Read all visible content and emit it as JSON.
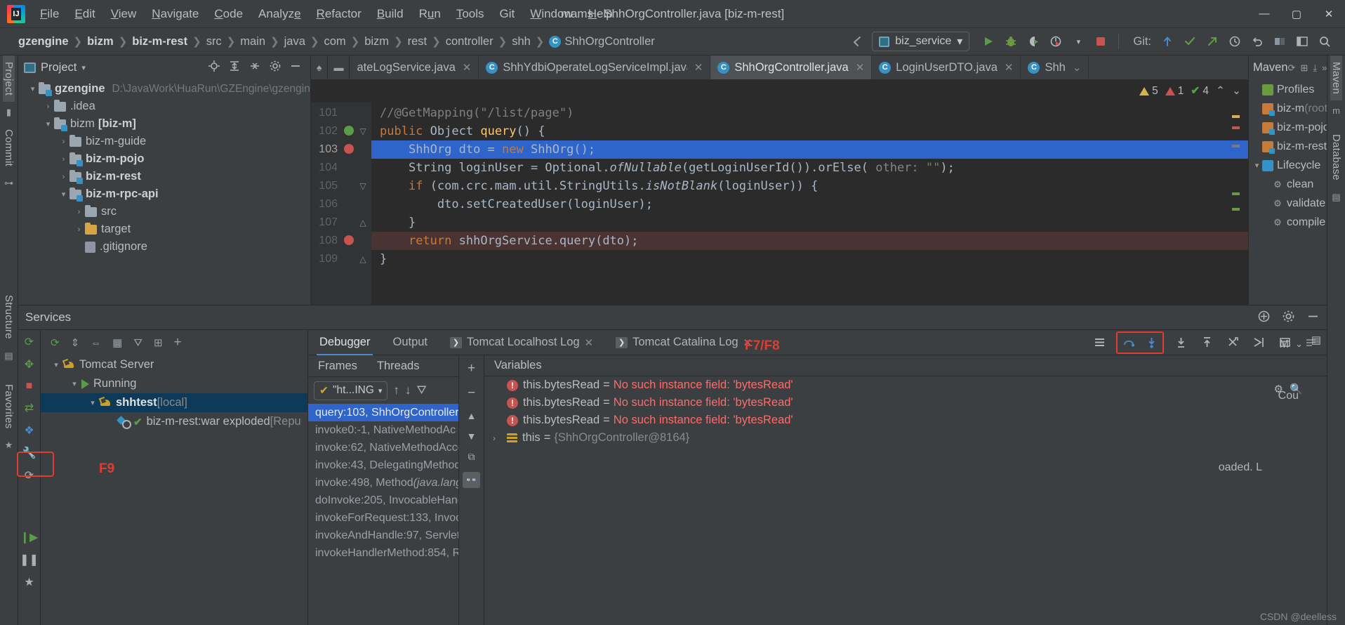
{
  "window": {
    "title": "mams - ShhOrgController.java [biz-m-rest]"
  },
  "menubar": {
    "items": [
      "File",
      "Edit",
      "View",
      "Navigate",
      "Code",
      "Analyze",
      "Refactor",
      "Build",
      "Run",
      "Tools",
      "Git",
      "Window",
      "Help"
    ]
  },
  "window_controls": {
    "minimize": "—",
    "maximize": "▢",
    "close": "✕"
  },
  "breadcrumb": {
    "items": [
      "gzengine",
      "bizm",
      "biz-m-rest",
      "src",
      "main",
      "java",
      "com",
      "bizm",
      "rest",
      "controller",
      "shh"
    ],
    "bold_count": 3,
    "class_icon": "C",
    "class_name": "ShhOrgController"
  },
  "toolbar": {
    "run_config": "biz_service",
    "run_config_icon": "tomcat-config-icon",
    "dropdown_caret": "▾",
    "run_button": "run-icon",
    "debug_button": "debug-icon",
    "run_coverage_button": "run-with-coverage-icon",
    "profiler_button": "profiler-icon",
    "stop_button": "stop-icon",
    "git_label": "Git:",
    "git_update": "update-project-icon",
    "git_commit": "commit-icon",
    "git_push": "push-icon",
    "history": "history-icon",
    "undo": "undo-icon",
    "search": "search-everywhere-icon"
  },
  "left_rail": {
    "items": [
      "Project",
      "Commit",
      "Structure",
      "Favorites"
    ]
  },
  "right_rail": {
    "items": [
      "Maven",
      "Database"
    ]
  },
  "project_panel": {
    "title": "Project",
    "caret": "▾",
    "toolbar_icons": [
      "locate-icon",
      "expand-all-icon",
      "collapse-all-icon",
      "settings-icon",
      "hide-icon"
    ],
    "tree": [
      {
        "depth": 0,
        "arrow": "▾",
        "label": "gzengine",
        "bold": true,
        "path": "D:\\JavaWork\\HuaRun\\GZEngine\\gzengine",
        "icon": "module-folder-icon"
      },
      {
        "depth": 1,
        "arrow": "›",
        "label": ".idea",
        "bold": false,
        "path": "",
        "icon": "folder-icon"
      },
      {
        "depth": 1,
        "arrow": "▾",
        "label": "bizm",
        "bold": false,
        "module": "[biz-m]",
        "path": "",
        "icon": "module-folder-icon"
      },
      {
        "depth": 2,
        "arrow": "›",
        "label": "biz-m-guide",
        "bold": false,
        "path": "",
        "icon": "folder-icon"
      },
      {
        "depth": 2,
        "arrow": "›",
        "label": "biz-m-pojo",
        "bold": true,
        "path": "",
        "icon": "module-folder-icon"
      },
      {
        "depth": 2,
        "arrow": "›",
        "label": "biz-m-rest",
        "bold": true,
        "path": "",
        "icon": "module-folder-icon"
      },
      {
        "depth": 2,
        "arrow": "▾",
        "label": "biz-m-rpc-api",
        "bold": true,
        "path": "",
        "icon": "module-folder-icon"
      },
      {
        "depth": 3,
        "arrow": "›",
        "label": "src",
        "bold": false,
        "path": "",
        "icon": "folder-icon"
      },
      {
        "depth": 3,
        "arrow": "›",
        "label": "target",
        "bold": false,
        "path": "",
        "icon": "target-folder-icon"
      },
      {
        "depth": 3,
        "arrow": "",
        "label": ".gitignore",
        "bold": false,
        "path": "",
        "icon": "file-icon"
      }
    ]
  },
  "editor": {
    "tabs": [
      {
        "label": "ateLogService.java",
        "active": false,
        "icon": "",
        "closable": true
      },
      {
        "label": "ShhYdbiOperateLogServiceImpl.java",
        "active": false,
        "icon": "C",
        "closable": true
      },
      {
        "label": "ShhOrgController.java",
        "active": true,
        "icon": "C",
        "closable": true
      },
      {
        "label": "LoginUserDTO.java",
        "active": false,
        "icon": "C",
        "closable": true
      },
      {
        "label": "Shh",
        "active": false,
        "icon": "C",
        "closable": false
      }
    ],
    "inspections": {
      "warnings": "5",
      "errors": "1",
      "checks": "4",
      "up": "⌃",
      "down": "⌄"
    },
    "lines": [
      {
        "num": "101",
        "marker": "",
        "fold": "",
        "state": "normal"
      },
      {
        "num": "102",
        "marker": "run-to-line-icon",
        "fold": "▽",
        "state": "normal"
      },
      {
        "num": "103",
        "marker": "breakpoint-icon",
        "fold": "",
        "state": "current"
      },
      {
        "num": "104",
        "marker": "",
        "fold": "",
        "state": "normal"
      },
      {
        "num": "105",
        "marker": "",
        "fold": "▽",
        "state": "normal"
      },
      {
        "num": "106",
        "marker": "",
        "fold": "",
        "state": "normal"
      },
      {
        "num": "107",
        "marker": "",
        "fold": "△",
        "state": "normal"
      },
      {
        "num": "108",
        "marker": "breakpoint-icon",
        "fold": "",
        "state": "error"
      },
      {
        "num": "109",
        "marker": "",
        "fold": "△",
        "state": "normal"
      }
    ],
    "code_text": [
      "//@GetMapping(\"/list/page\")",
      "public Object query() {",
      "    ShhOrg dto = new ShhOrg();",
      "    String loginUser = Optional.ofNullable(getLoginUserId()).orElse( other: \"\");",
      "    if (com.crc.mam.util.StringUtils.isNotBlank(loginUser)) {",
      "        dto.setCreatedUser(loginUser);",
      "    }",
      "    return shhOrgService.query(dto);",
      "}"
    ]
  },
  "maven_panel": {
    "title": "Maven",
    "toolbar_icons": [
      "refresh-icon",
      "add-maven-icon",
      "download-sources-icon",
      "more-icon"
    ],
    "rows": [
      {
        "depth": 0,
        "arrow": "",
        "icon": "profiles-icon",
        "label": "Profiles"
      },
      {
        "depth": 0,
        "arrow": "",
        "icon": "maven-project-icon",
        "label": "biz-m",
        "suffix": "(root)"
      },
      {
        "depth": 0,
        "arrow": "",
        "icon": "maven-project-icon",
        "label": "biz-m-pojo",
        "suffix": ""
      },
      {
        "depth": 0,
        "arrow": "",
        "icon": "maven-project-icon",
        "label": "biz-m-rest",
        "suffix": ""
      },
      {
        "depth": 0,
        "arrow": "▾",
        "icon": "lifecycle-icon",
        "label": "Lifecycle",
        "suffix": ""
      },
      {
        "depth": 1,
        "arrow": "",
        "icon": "goal-icon",
        "label": "clean",
        "suffix": ""
      },
      {
        "depth": 1,
        "arrow": "",
        "icon": "goal-icon",
        "label": "validate",
        "suffix": ""
      },
      {
        "depth": 1,
        "arrow": "",
        "icon": "goal-icon",
        "label": "compile",
        "suffix": ""
      }
    ]
  },
  "services": {
    "title": "Services",
    "head_icons": [
      "add-service-icon",
      "settings-icon",
      "hide-icon"
    ],
    "left_rail_icons": [
      "rerun-icon",
      "deploy-icon",
      "stop-icon",
      "redeploy-icon",
      "edit-config-icon",
      "repair-icon",
      "refresh-icon"
    ],
    "tree_toolbar_icons": [
      "rerun-icon",
      "expand-all-icon",
      "collapse-all-icon",
      "group-icon",
      "filter-icon",
      "add-tab-icon",
      "add-icon"
    ],
    "tree": [
      {
        "depth": 0,
        "arrow": "▾",
        "icon": "tomcat-icon",
        "label": "Tomcat Server",
        "bold": false,
        "suffix": "",
        "selected": false
      },
      {
        "depth": 1,
        "arrow": "▾",
        "icon": "running-icon",
        "label": "Running",
        "bold": false,
        "suffix": "",
        "selected": false
      },
      {
        "depth": 2,
        "arrow": "▾",
        "icon": "tomcat-run-icon",
        "label": "shhtest",
        "bold": true,
        "suffix": "[local]",
        "selected": true
      },
      {
        "depth": 3,
        "arrow": "",
        "icon": "artifact-icon",
        "label": "biz-m-rest:war exploded",
        "bold": false,
        "suffix": "[Repu",
        "selected": false
      }
    ],
    "debug_tabs": [
      {
        "label": "Debugger",
        "active": true,
        "icon": "",
        "closable": false
      },
      {
        "label": "Output",
        "active": false,
        "icon": "",
        "closable": false
      },
      {
        "label": "Tomcat Localhost Log",
        "active": false,
        "icon": "log-icon",
        "closable": true
      },
      {
        "label": "Tomcat Catalina Log",
        "active": false,
        "icon": "log-icon",
        "closable": true
      }
    ],
    "debug_tools": [
      "layout-icon",
      "mute-breakpoints-icon",
      "step-over-icon",
      "step-into-icon",
      "force-step-into-icon",
      "step-out-icon",
      "run-to-cursor-icon",
      "evaluate-icon",
      "settings-icon"
    ],
    "frames": {
      "header": "Frames",
      "threads_header": "Threads",
      "thread_selector": "\"ht...ING",
      "thread_check": "✔",
      "thread_caret": "▾",
      "toolbar": [
        "up-icon",
        "down-icon",
        "filter-icon"
      ],
      "items": [
        {
          "label": "query:103, ShhOrgController",
          "italic": "",
          "selected": true
        },
        {
          "label": "invoke0:-1, NativeMethodAc",
          "italic": "",
          "selected": false
        },
        {
          "label": "invoke:62, NativeMethodAcce",
          "italic": "",
          "selected": false
        },
        {
          "label": "invoke:43, DelegatingMethod",
          "italic": "",
          "selected": false
        },
        {
          "label": "invoke:498, Method ",
          "italic": "(java.lang",
          "selected": false
        },
        {
          "label": "doInvoke:205, InvocableHand",
          "italic": "",
          "selected": false
        },
        {
          "label": "invokeForRequest:133, Invoca",
          "italic": "",
          "selected": false
        },
        {
          "label": "invokeAndHandle:97, ServletIn",
          "italic": "",
          "selected": false
        },
        {
          "label": "invokeHandlerMethod:854, Re",
          "italic": "",
          "selected": false
        }
      ]
    },
    "variables": {
      "header": "Variables",
      "side_icons": [
        "add-watch-icon",
        "remove-watch-icon",
        "up-icon",
        "down-icon",
        "copy-icon",
        "inspect-icon"
      ],
      "items": [
        {
          "type": "error",
          "name": "this.bytesRead",
          "value": "No such instance field: 'bytesRead'",
          "arrow": ""
        },
        {
          "type": "error",
          "name": "this.bytesRead",
          "value": "No such instance field: 'bytesRead'",
          "arrow": ""
        },
        {
          "type": "error",
          "name": "this.bytesRead",
          "value": "No such instance field: 'bytesRead'",
          "arrow": ""
        },
        {
          "type": "object",
          "name": "this",
          "value": "{ShhOrgController@8164}",
          "arrow": "›"
        }
      ]
    },
    "console_fragment": "oaded. L",
    "right_label": "Cou",
    "right_caret_label": "M"
  },
  "annotations": [
    {
      "id": "f9",
      "text": "F9"
    },
    {
      "id": "f7f8",
      "text": "F7/F8"
    }
  ],
  "watermark": "CSDN @deelless",
  "colors": {
    "accent_blue": "#3592c4",
    "selection_blue": "#2f65ca",
    "error_red": "#ff6b68",
    "annotation_red": "#e03c31",
    "panel_bg": "#3c3f41",
    "editor_bg": "#2b2b2b",
    "keyword_orange": "#cc7832",
    "string_green": "#6a8759",
    "method_yellow": "#ffc66d"
  }
}
